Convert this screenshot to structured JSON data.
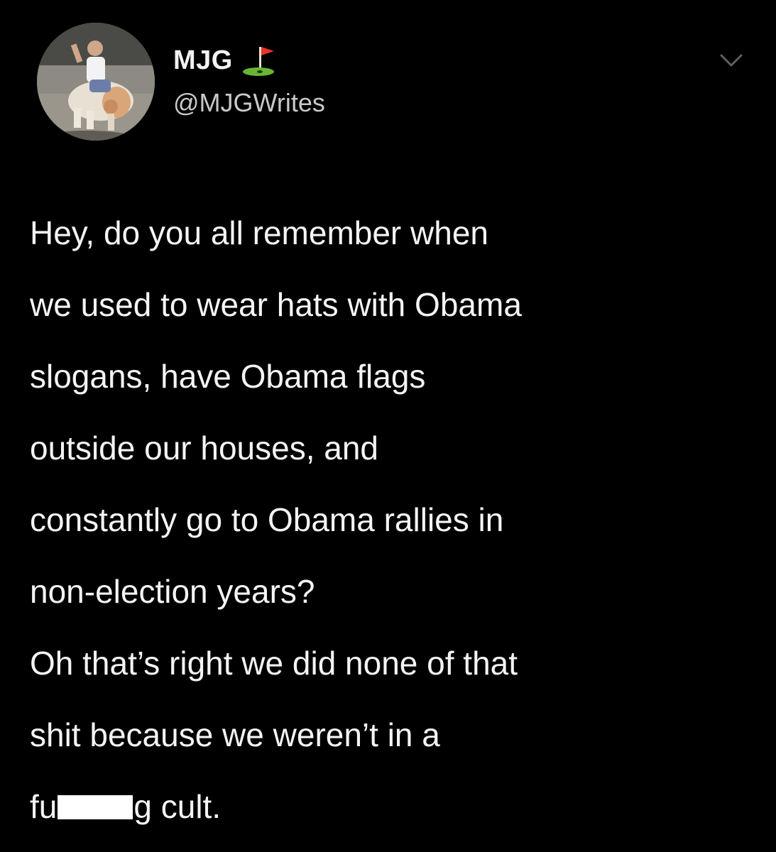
{
  "tweet": {
    "display_name": "MJG",
    "handle": "@MJGWrites",
    "paragraph1_lines": [
      "Hey, do you all remember when",
      "we used to wear hats with Obama",
      "slogans, have Obama flags",
      "outside our houses, and",
      "constantly go to Obama rallies in",
      "non-election years?"
    ],
    "paragraph2_lines": [
      "Oh that’s right we did none of that",
      "shit because we weren’t in a"
    ],
    "last_line_prefix": "fu",
    "last_line_suffix": "g cult."
  },
  "icons": {
    "avatar": "avatar",
    "flag": "golf-flag-icon",
    "chevron": "chevron-down-icon"
  },
  "colors": {
    "background": "#000000",
    "text": "#f4f4f4",
    "handle": "#c9c9c9",
    "flag_red": "#e8352b",
    "green": "#6ab536"
  }
}
